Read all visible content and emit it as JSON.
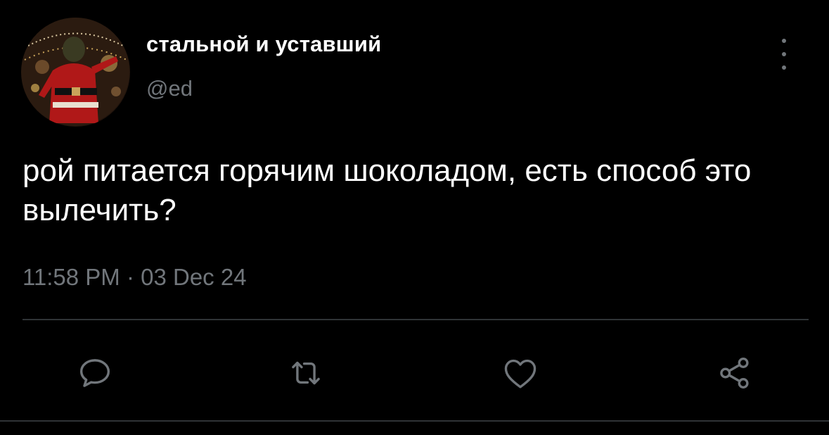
{
  "tweet": {
    "display_name": "стальной и уставший",
    "handle": "@ed",
    "text": "рой питается горячим шоколадом, есть способ это вылечить?",
    "timestamp": "11:58 PM · 03 Dec 24"
  },
  "icons": {
    "more": "more-vertical-icon",
    "reply": "reply-icon",
    "retweet": "retweet-icon",
    "like": "heart-icon",
    "share": "share-icon"
  },
  "colors": {
    "background": "#000000",
    "text": "#ffffff",
    "secondary": "#71767b",
    "divider": "#2f3336"
  }
}
